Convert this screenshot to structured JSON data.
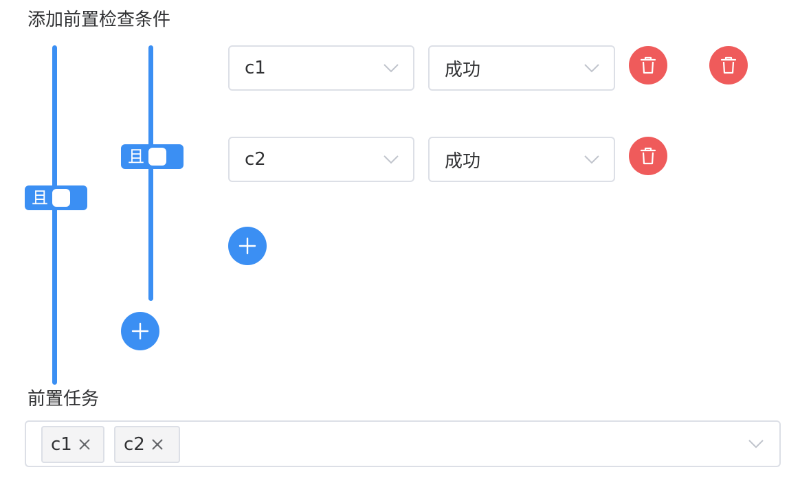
{
  "header": {
    "title": "添加前置检查条件"
  },
  "outer_group": {
    "operator_label": "且"
  },
  "inner_group": {
    "operator_label": "且"
  },
  "conditions": [
    {
      "task": "c1",
      "status": "成功"
    },
    {
      "task": "c2",
      "status": "成功"
    }
  ],
  "prerequisite_tasks": {
    "title": "前置任务",
    "selected": [
      "c1",
      "c2"
    ]
  },
  "colors": {
    "primary": "#3b8ff3",
    "danger": "#ef5b5b",
    "border": "#dcdfe6"
  },
  "icons": {
    "dropdown": "chevron-down-icon",
    "delete": "trash-icon",
    "add": "plus-icon",
    "remove_tag": "close-icon"
  }
}
